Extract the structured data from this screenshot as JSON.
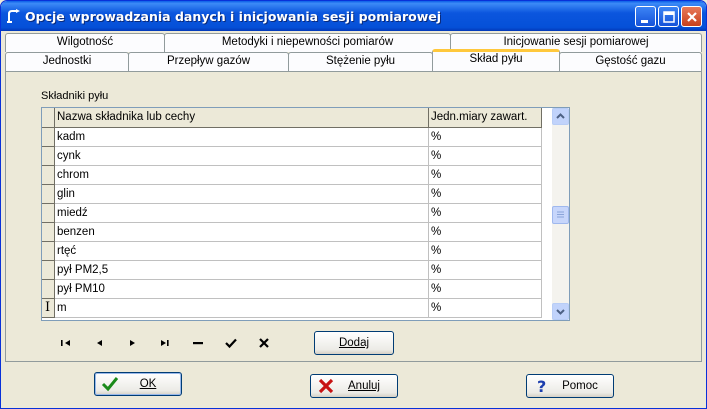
{
  "window": {
    "title": "Opcje wprowadzania danych i inicjowania sesji pomiarowej"
  },
  "tabs": {
    "row1": [
      "Wilgotność",
      "Metodyki i niepewności pomiarów",
      "Inicjowanie sesji pomiarowej"
    ],
    "row2": [
      "Jednostki",
      "Przepływ gazów",
      "Stężenie pyłu",
      "Skład pyłu",
      "Gęstość gazu"
    ],
    "active": "Skład pyłu"
  },
  "section": {
    "label": "Składniki pyłu"
  },
  "grid": {
    "columns": [
      "Nazwa składnika lub cechy",
      "Jedn.miary zawart."
    ],
    "rows": [
      [
        "kadm",
        "%"
      ],
      [
        "cynk",
        "%"
      ],
      [
        "chrom",
        "%"
      ],
      [
        "glin",
        "%"
      ],
      [
        "miedź",
        "%"
      ],
      [
        "benzen",
        "%"
      ],
      [
        "rtęć",
        "%"
      ],
      [
        "pył PM2,5",
        "%"
      ],
      [
        "pył PM10",
        "%"
      ],
      [
        "m",
        "%"
      ]
    ]
  },
  "navigator": {
    "icons": [
      "first-icon",
      "prior-icon",
      "next-icon",
      "last-icon",
      "delete-icon",
      "post-icon",
      "cancel-icon"
    ]
  },
  "buttons": {
    "add": "Dodaj",
    "ok": "OK",
    "cancel": "Anuluj",
    "help": "Pomoc"
  }
}
